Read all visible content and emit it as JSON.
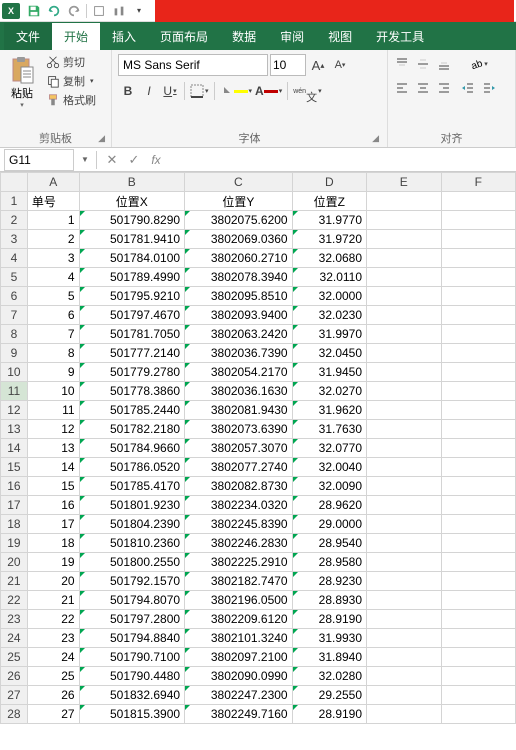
{
  "qat": {
    "app": "X"
  },
  "tabs": {
    "file": "文件",
    "home": "开始",
    "insert": "插入",
    "page_layout": "页面布局",
    "data": "数据",
    "review": "审阅",
    "view": "视图",
    "developer": "开发工具"
  },
  "ribbon": {
    "clipboard": {
      "label": "剪贴板",
      "paste": "粘贴",
      "cut": "剪切",
      "copy": "复制",
      "format_painter": "格式刷"
    },
    "font": {
      "label": "字体",
      "name": "MS Sans Serif",
      "size": "10",
      "bold": "B",
      "italic": "I",
      "underline": "U"
    },
    "align": {
      "label": "对齐"
    }
  },
  "namebox": "G11",
  "columns": [
    "A",
    "B",
    "C",
    "D",
    "E",
    "F"
  ],
  "headers": {
    "a": "单号",
    "b": "位置X",
    "c": "位置Y",
    "d": "位置Z"
  },
  "rows": [
    {
      "n": 1,
      "a": "1",
      "b": "501790.8290",
      "c": "3802075.6200",
      "d": "31.9770"
    },
    {
      "n": 2,
      "a": "2",
      "b": "501781.9410",
      "c": "3802069.0360",
      "d": "31.9720"
    },
    {
      "n": 3,
      "a": "3",
      "b": "501784.0100",
      "c": "3802060.2710",
      "d": "32.0680"
    },
    {
      "n": 4,
      "a": "4",
      "b": "501789.4990",
      "c": "3802078.3940",
      "d": "32.0110"
    },
    {
      "n": 5,
      "a": "5",
      "b": "501795.9210",
      "c": "3802095.8510",
      "d": "32.0000"
    },
    {
      "n": 6,
      "a": "6",
      "b": "501797.4670",
      "c": "3802093.9400",
      "d": "32.0230"
    },
    {
      "n": 7,
      "a": "7",
      "b": "501781.7050",
      "c": "3802063.2420",
      "d": "31.9970"
    },
    {
      "n": 8,
      "a": "8",
      "b": "501777.2140",
      "c": "3802036.7390",
      "d": "32.0450"
    },
    {
      "n": 9,
      "a": "9",
      "b": "501779.2780",
      "c": "3802054.2170",
      "d": "31.9450"
    },
    {
      "n": 10,
      "a": "10",
      "b": "501778.3860",
      "c": "3802036.1630",
      "d": "32.0270"
    },
    {
      "n": 11,
      "a": "11",
      "b": "501785.2440",
      "c": "3802081.9430",
      "d": "31.9620"
    },
    {
      "n": 12,
      "a": "12",
      "b": "501782.2180",
      "c": "3802073.6390",
      "d": "31.7630"
    },
    {
      "n": 13,
      "a": "13",
      "b": "501784.9660",
      "c": "3802057.3070",
      "d": "32.0770"
    },
    {
      "n": 14,
      "a": "14",
      "b": "501786.0520",
      "c": "3802077.2740",
      "d": "32.0040"
    },
    {
      "n": 15,
      "a": "15",
      "b": "501785.4170",
      "c": "3802082.8730",
      "d": "32.0090"
    },
    {
      "n": 16,
      "a": "16",
      "b": "501801.9230",
      "c": "3802234.0320",
      "d": "28.9620"
    },
    {
      "n": 17,
      "a": "17",
      "b": "501804.2390",
      "c": "3802245.8390",
      "d": "29.0000"
    },
    {
      "n": 18,
      "a": "18",
      "b": "501810.2360",
      "c": "3802246.2830",
      "d": "28.9540"
    },
    {
      "n": 19,
      "a": "19",
      "b": "501800.2550",
      "c": "3802225.2910",
      "d": "28.9580"
    },
    {
      "n": 20,
      "a": "20",
      "b": "501792.1570",
      "c": "3802182.7470",
      "d": "28.9230"
    },
    {
      "n": 21,
      "a": "21",
      "b": "501794.8070",
      "c": "3802196.0500",
      "d": "28.8930"
    },
    {
      "n": 22,
      "a": "22",
      "b": "501797.2800",
      "c": "3802209.6120",
      "d": "28.9190"
    },
    {
      "n": 23,
      "a": "23",
      "b": "501794.8840",
      "c": "3802101.3240",
      "d": "31.9930"
    },
    {
      "n": 24,
      "a": "24",
      "b": "501790.7100",
      "c": "3802097.2100",
      "d": "31.8940"
    },
    {
      "n": 25,
      "a": "25",
      "b": "501790.4480",
      "c": "3802090.0990",
      "d": "32.0280"
    },
    {
      "n": 26,
      "a": "26",
      "b": "501832.6940",
      "c": "3802247.2300",
      "d": "29.2550"
    },
    {
      "n": 27,
      "a": "27",
      "b": "501815.3900",
      "c": "3802249.7160",
      "d": "28.9190"
    }
  ],
  "active_row": 11
}
